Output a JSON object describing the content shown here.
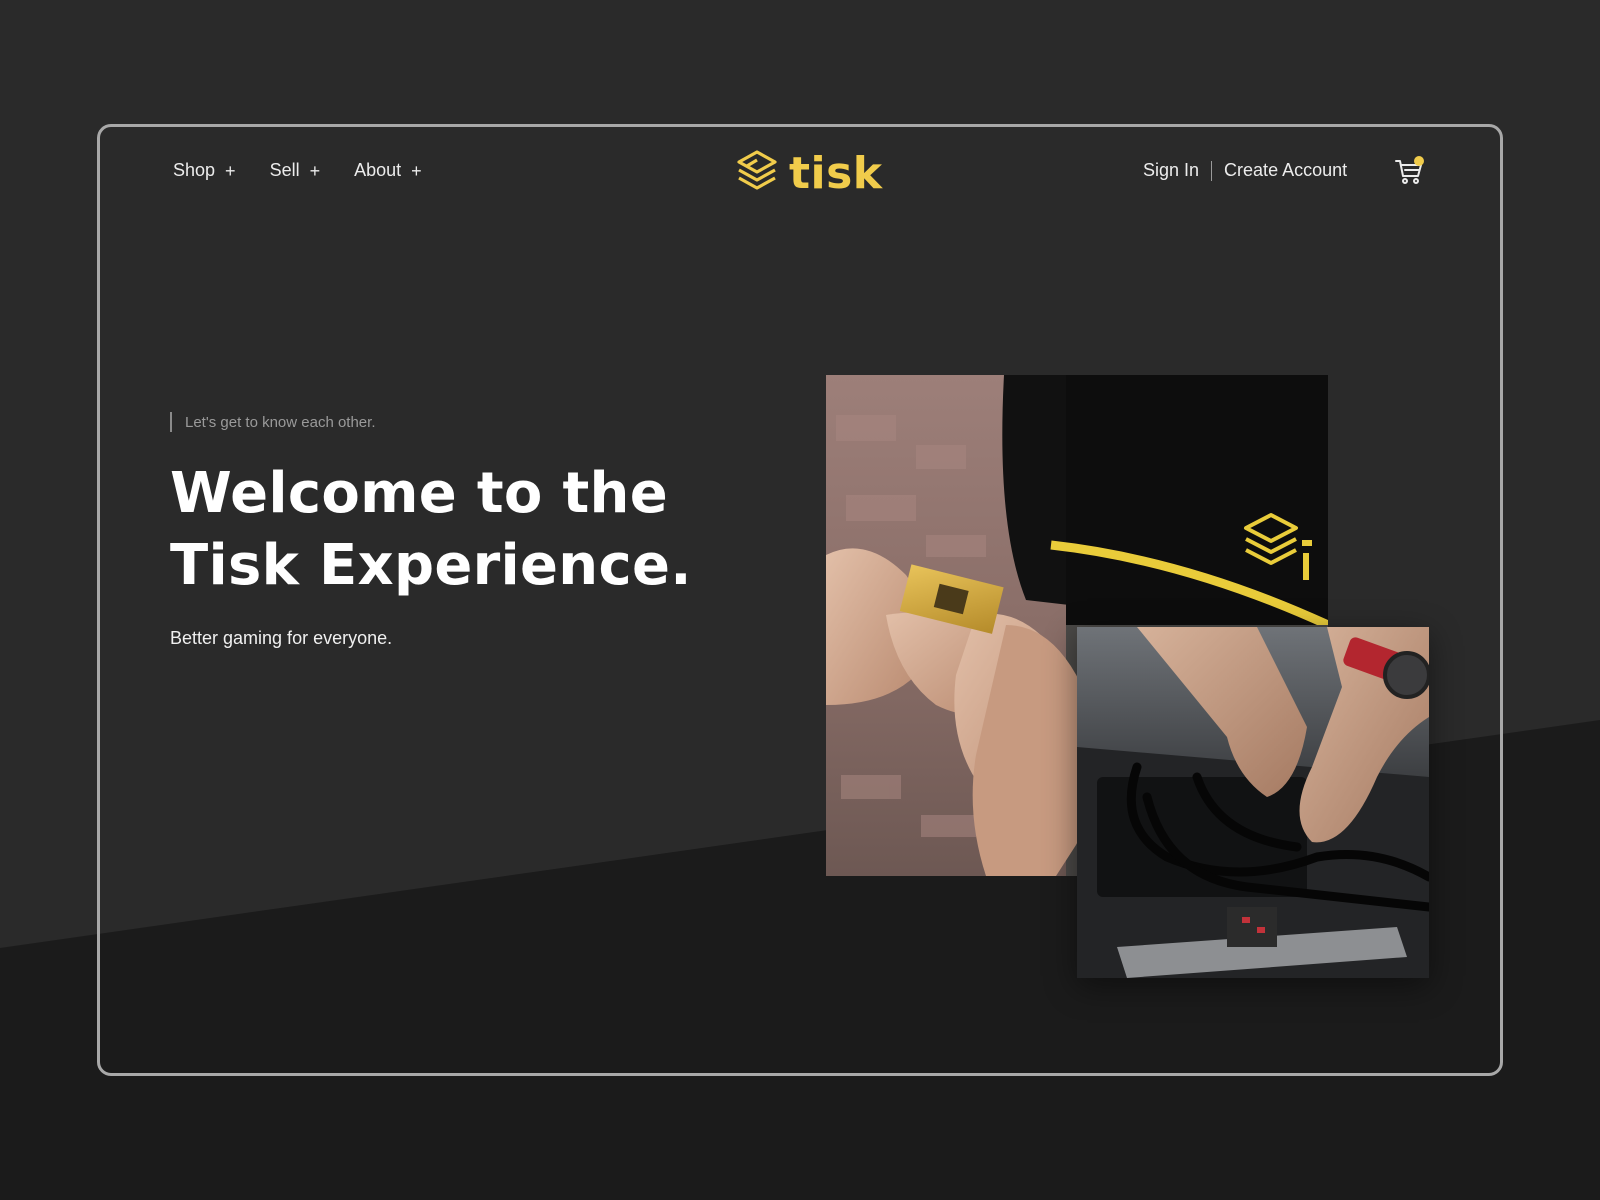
{
  "nav": {
    "items": [
      {
        "label": "Shop",
        "icon": "plus-icon"
      },
      {
        "label": "Sell",
        "icon": "plus-icon"
      },
      {
        "label": "About",
        "icon": "plus-icon"
      }
    ],
    "plus_glyph": "+",
    "sign_in": "Sign In",
    "create_account": "Create Account",
    "cart_icon": "cart-icon",
    "cart_badge": "notification-dot"
  },
  "brand": {
    "name": "tisk",
    "logo_icon": "stacked-layers-icon",
    "accent_color": "#f1cc4b"
  },
  "hero": {
    "eyebrow": "Let's get to know each other.",
    "headline_line1": "Welcome to the",
    "headline_line2": "Tisk Experience.",
    "subheadline": "Better gaming for everyone."
  },
  "images": [
    {
      "name": "cpu-handoff-photo",
      "shows_brand_text": "ti"
    },
    {
      "name": "pc-build-photo"
    }
  ],
  "colors": {
    "background": "#2a2a2a",
    "background_lower": "#1b1b1b",
    "frame_border": "#a8a8a8",
    "text": "#ffffff",
    "muted_text": "#9a9a9a"
  }
}
